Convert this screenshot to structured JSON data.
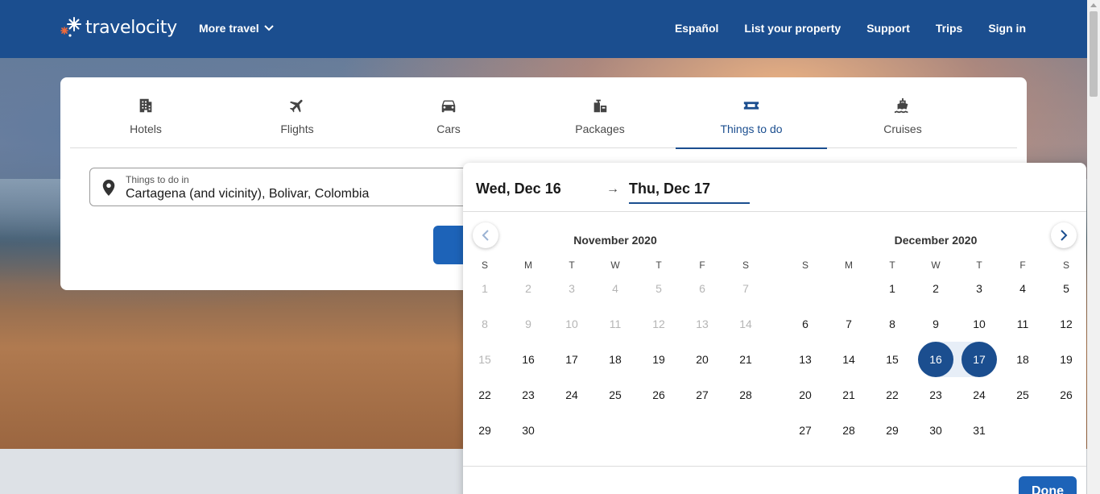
{
  "header": {
    "logo_text": "travelocity",
    "more_travel": "More travel",
    "nav": [
      "Español",
      "List your property",
      "Support",
      "Trips",
      "Sign in"
    ]
  },
  "tabs": [
    {
      "label": "Hotels",
      "icon": "building-icon"
    },
    {
      "label": "Flights",
      "icon": "plane-icon"
    },
    {
      "label": "Cars",
      "icon": "car-icon"
    },
    {
      "label": "Packages",
      "icon": "packages-icon"
    },
    {
      "label": "Things to do",
      "icon": "ticket-icon"
    },
    {
      "label": "Cruises",
      "icon": "ship-icon"
    }
  ],
  "active_tab": "Things to do",
  "destination": {
    "label": "Things to do in",
    "value": "Cartagena (and vicinity), Bolivar, Colombia"
  },
  "calendar": {
    "start_date": "Wed, Dec 16",
    "end_date": "Thu, Dec 17",
    "weekdays": [
      "S",
      "M",
      "T",
      "W",
      "T",
      "F",
      "S"
    ],
    "months": [
      {
        "title": "November 2020",
        "first_weekday": 0,
        "days": 30,
        "disabled_through": 15
      },
      {
        "title": "December 2020",
        "first_weekday": 2,
        "days": 31,
        "disabled_through": 0
      }
    ],
    "selected": {
      "month": 1,
      "start": 16,
      "end": 17
    },
    "done_label": "Done"
  },
  "colors": {
    "brand": "#1b4e8f",
    "button": "#1d63b8"
  }
}
